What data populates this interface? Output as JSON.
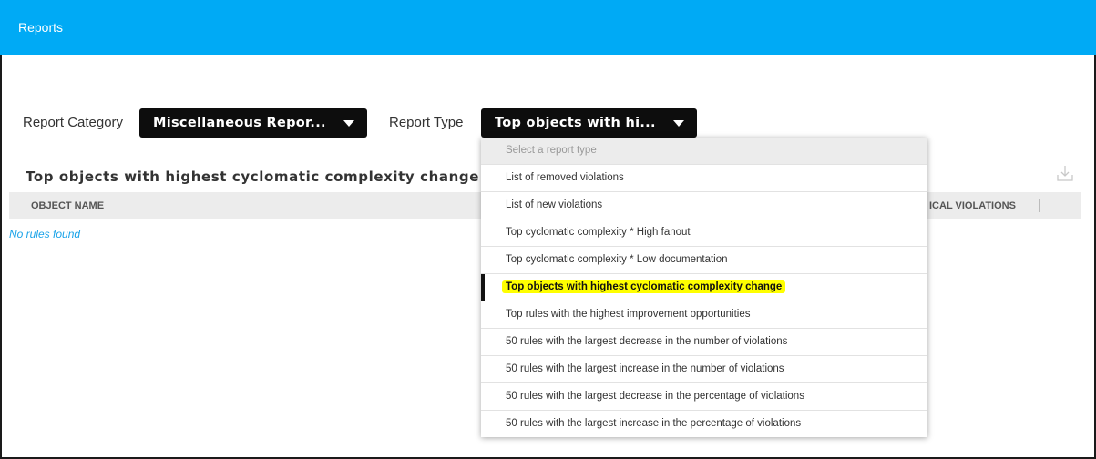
{
  "header": {
    "title": "Reports"
  },
  "filters": {
    "category_label": "Report Category",
    "category_value": "Miscellaneous Repor...",
    "type_label": "Report Type",
    "type_value": "Top objects with hi..."
  },
  "section": {
    "title": "Top objects with highest cyclomatic complexity change"
  },
  "table": {
    "columns": [
      "OBJECT NAME",
      "ICAL VIOLATIONS"
    ],
    "empty_message": "No rules found"
  },
  "dropdown": {
    "placeholder": "Select a report type",
    "items": [
      "List of removed violations",
      "List of new violations",
      "Top cyclomatic complexity * High fanout",
      "Top cyclomatic complexity * Low documentation",
      "Top objects with highest cyclomatic complexity change",
      "Top rules with the highest improvement opportunities",
      "50 rules with the largest decrease in the number of violations",
      "50 rules with the largest increase in the number of violations",
      "50 rules with the largest decrease in the percentage of violations",
      "50 rules with the largest increase in the percentage of violations"
    ],
    "selected_index": 4
  },
  "icons": {
    "download": "download-icon",
    "caret": "chevron-down-icon"
  },
  "colors": {
    "header": "#00aaf5",
    "select_bg": "#0d0d0d",
    "highlight": "#ffff00",
    "empty_text": "#1aa3e8"
  }
}
